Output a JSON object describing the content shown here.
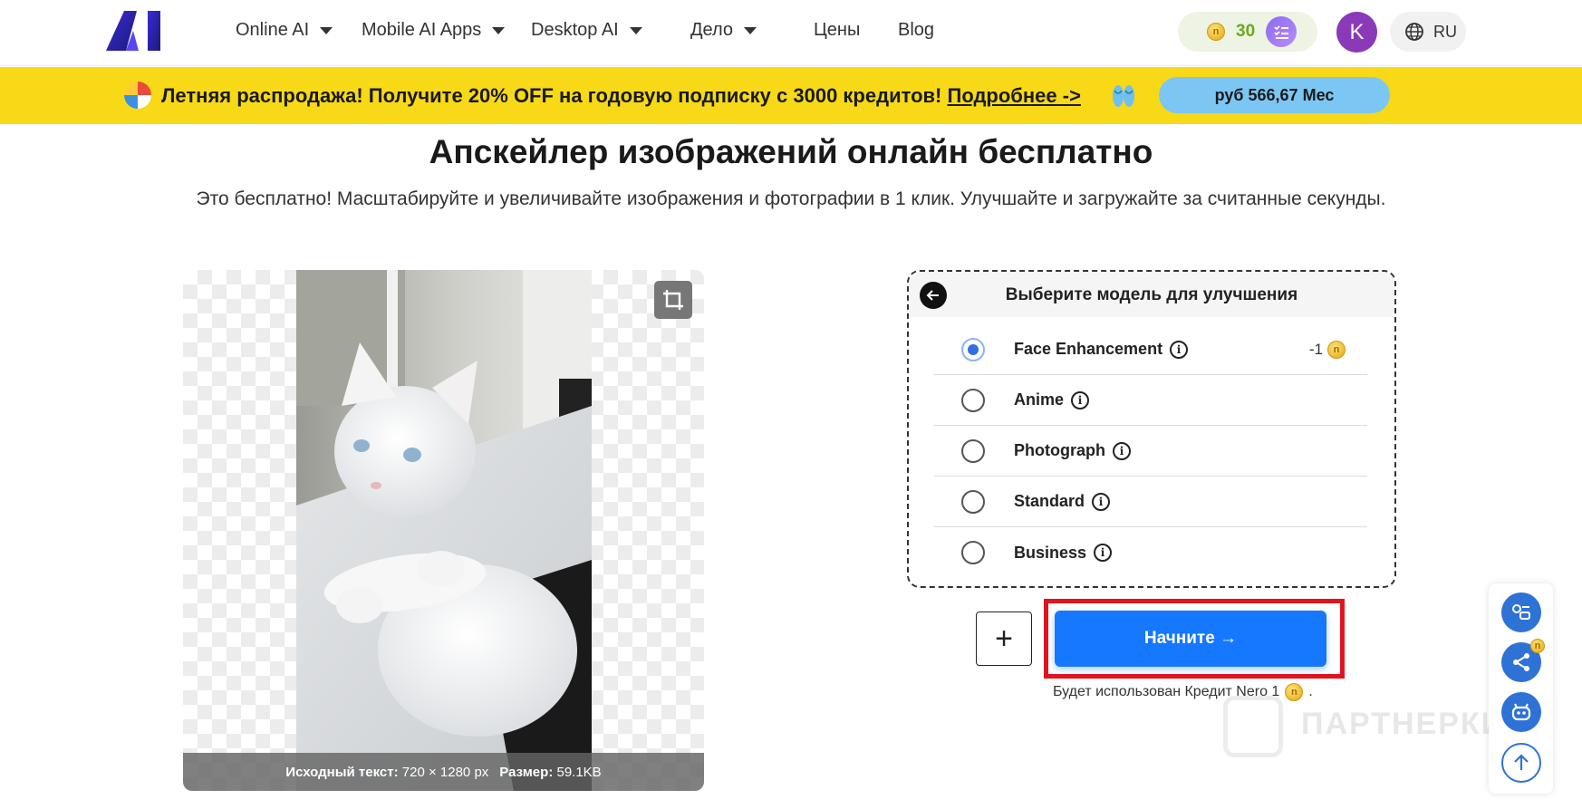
{
  "header": {
    "logo_text": "AI",
    "nav": [
      {
        "label": "Online AI",
        "dropdown": true
      },
      {
        "label": "Mobile AI Apps",
        "dropdown": true
      },
      {
        "label": "Desktop AI",
        "dropdown": true
      },
      {
        "label": "Дело",
        "dropdown": true
      },
      {
        "label": "Цены",
        "dropdown": false
      },
      {
        "label": "Blog",
        "dropdown": false
      }
    ],
    "credits": "30",
    "avatar_letter": "K",
    "language": "RU"
  },
  "promo": {
    "text": "Летняя распродажа! Получите 20% OFF на годовую подписку с 3000 кредитов!",
    "link": "Подробнее ->",
    "price": "руб 566,67 Мес",
    "background": "#f7d917"
  },
  "hero": {
    "title": "Апскейлер изображений онлайн бесплатно",
    "subtitle": "Это бесплатно! Масштабируйте и увеличивайте изображения и фотографии в 1 клик. Улучшайте и загружайте за считанные секунды."
  },
  "preview": {
    "source_label": "Исходный текст:",
    "source_value": "720 × 1280 px",
    "size_label": "Размер:",
    "size_value": "59.1KB"
  },
  "model_panel": {
    "title": "Выберите модель для улучшения",
    "options": [
      {
        "label": "Face Enhancement",
        "selected": true,
        "cost": "-1"
      },
      {
        "label": "Anime",
        "selected": false
      },
      {
        "label": "Photograph",
        "selected": false
      },
      {
        "label": "Standard",
        "selected": false
      },
      {
        "label": "Business",
        "selected": false
      }
    ]
  },
  "actions": {
    "add_label": "+",
    "start_label": "Начните →",
    "credit_note": "Будет использован Кредит Nero 1",
    "credit_note_suffix": ".",
    "accent": "#1677ff",
    "highlight_color": "#e0141e"
  },
  "watermark": "ПАРТНЕРКИН",
  "icons": {
    "crop": "crop-icon",
    "back": "arrow-left-icon",
    "tasks": "task-list-icon",
    "language": "globe-icon",
    "float": [
      "chat-icon",
      "share-icon",
      "bot-icon",
      "arrow-up-icon"
    ]
  }
}
